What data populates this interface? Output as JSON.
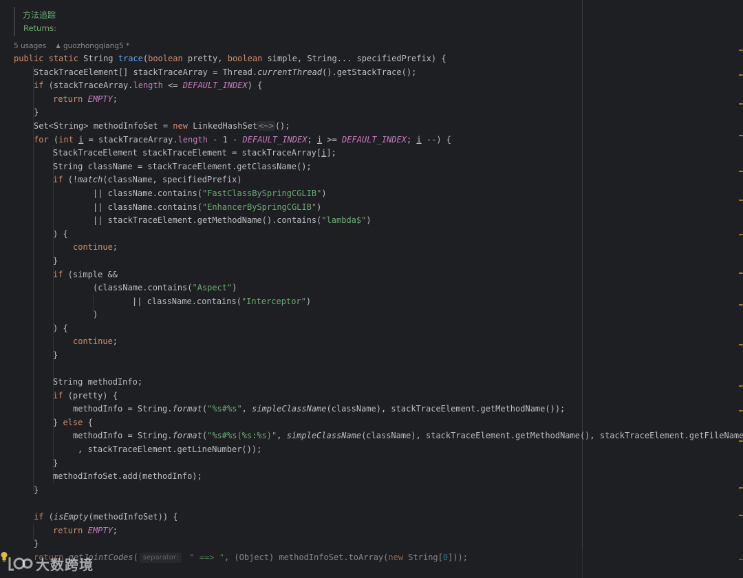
{
  "doc": {
    "title": "方法追踪",
    "returns": "Returns:"
  },
  "meta": {
    "usages": "5 usages",
    "author": "guozhongqiang5 *"
  },
  "hint": {
    "separator": "separator:"
  },
  "watermark": {
    "text": "大数跨境"
  },
  "icons": [
    "user-icon",
    "lightbulb-icon",
    "watermark-logo-icon"
  ],
  "colors": {
    "background": "#1e1f22",
    "keyword": "#cf8e6d",
    "string": "#6aab73",
    "field": "#c77dbb",
    "function": "#56a8f5",
    "number": "#2aacb8"
  },
  "code": {
    "l1": {
      "t1": "public",
      "t2": " ",
      "t3": "static",
      "t4": " String ",
      "t5": "trace",
      "t6": "(",
      "t7": "boolean",
      "t8": " pretty, ",
      "t9": "boolean",
      "t10": " simple, String... specifiedPrefix) {"
    },
    "l2": {
      "t1": "StackTraceElement[] stackTraceArray = Thread.",
      "t2": "currentThread",
      "t3": "().getStackTrace();"
    },
    "l3": {
      "t1": "if",
      "t2": " (stackTraceArray.",
      "t3": "length",
      "t4": " <= ",
      "t5": "DEFAULT_INDEX",
      "t6": ") {"
    },
    "l4": {
      "t1": "return",
      "t2": " ",
      "t3": "EMPTY",
      "t4": ";"
    },
    "l5": {
      "t1": "}"
    },
    "l6": {
      "t1": "Set<String> methodInfoSet = ",
      "t2": "new",
      "t3": " LinkedHashSet",
      "t4": "<~>",
      "t5": "();"
    },
    "l7": {
      "t1": "for",
      "t2": " (",
      "t3": "int",
      "t4": " ",
      "t5": "i",
      "t6": " = stackTraceArray.",
      "t7": "length",
      "t8": " - 1 - ",
      "t9": "DEFAULT_INDEX",
      "t10": "; ",
      "t11": "i",
      "t12": " >= ",
      "t13": "DEFAULT_INDEX",
      "t14": "; ",
      "t15": "i",
      "t16": " --) {"
    },
    "l8": {
      "t1": "StackTraceElement stackTraceElement = stackTraceArray[",
      "t2": "i",
      "t3": "];"
    },
    "l9": {
      "t1": "String className = stackTraceElement.getClassName();"
    },
    "l10": {
      "t1": "if",
      "t2": " (!",
      "t3": "match",
      "t4": "(className, specifiedPrefix)"
    },
    "l11": {
      "t1": "|| className.contains(",
      "t2": "\"FastClassBySpringCGLIB\"",
      "t3": ")"
    },
    "l12": {
      "t1": "|| className.contains(",
      "t2": "\"EnhancerBySpringCGLIB\"",
      "t3": ")"
    },
    "l13": {
      "t1": "|| stackTraceElement.getMethodName().contains(",
      "t2": "\"lambda$\"",
      "t3": ")"
    },
    "l14": {
      "t1": ") {"
    },
    "l15": {
      "t1": "continue",
      "t2": ";"
    },
    "l16": {
      "t1": "}"
    },
    "l17": {
      "t1": "if",
      "t2": " (simple &&"
    },
    "l18": {
      "t1": "(className.contains(",
      "t2": "\"Aspect\"",
      "t3": ")"
    },
    "l19": {
      "t1": "|| className.contains(",
      "t2": "\"Interceptor\"",
      "t3": ")"
    },
    "l20": {
      "t1": ")"
    },
    "l21": {
      "t1": ") {"
    },
    "l22": {
      "t1": "continue",
      "t2": ";"
    },
    "l23": {
      "t1": "}"
    },
    "l24": {
      "t1": "String methodInfo;"
    },
    "l25": {
      "t1": "if",
      "t2": " (pretty) {"
    },
    "l26": {
      "t1": "methodInfo = String.",
      "t2": "format",
      "t3": "(",
      "t4": "\"%s#%s\"",
      "t5": ", ",
      "t6": "simpleClassName",
      "t7": "(className), stackTraceElement.getMethodName());"
    },
    "l27": {
      "t1": "} ",
      "t2": "else",
      "t3": " {"
    },
    "l28": {
      "t1": "methodInfo = String.",
      "t2": "format",
      "t3": "(",
      "t4": "\"%s#%s(%s:%s)\"",
      "t5": ", ",
      "t6": "simpleClassName",
      "t7": "(className), stackTraceElement.getMethodName(), stackTraceElement.getFileName()"
    },
    "l29": {
      "t1": ", stackTraceElement.getLineNumber());"
    },
    "l30": {
      "t1": "}"
    },
    "l31": {
      "t1": "methodInfoSet.add(methodInfo);"
    },
    "l32": {
      "t1": "}"
    },
    "l33": {
      "t1": "if",
      "t2": " (",
      "t3": "isEmpty",
      "t4": "(methodInfoSet)) {"
    },
    "l34": {
      "t1": "return",
      "t2": " ",
      "t3": "EMPTY",
      "t4": ";"
    },
    "l35": {
      "t1": "}"
    },
    "l36": {
      "t1": "return",
      "t2": " ",
      "t3": "getJointCodes",
      "t4": "(",
      "t5": " \" ==> \"",
      "t6": ", (Object) methodInfoSet.toArray(",
      "t7": "new",
      "t8": " String[",
      "t9": "0",
      "t10": "]));"
    }
  }
}
